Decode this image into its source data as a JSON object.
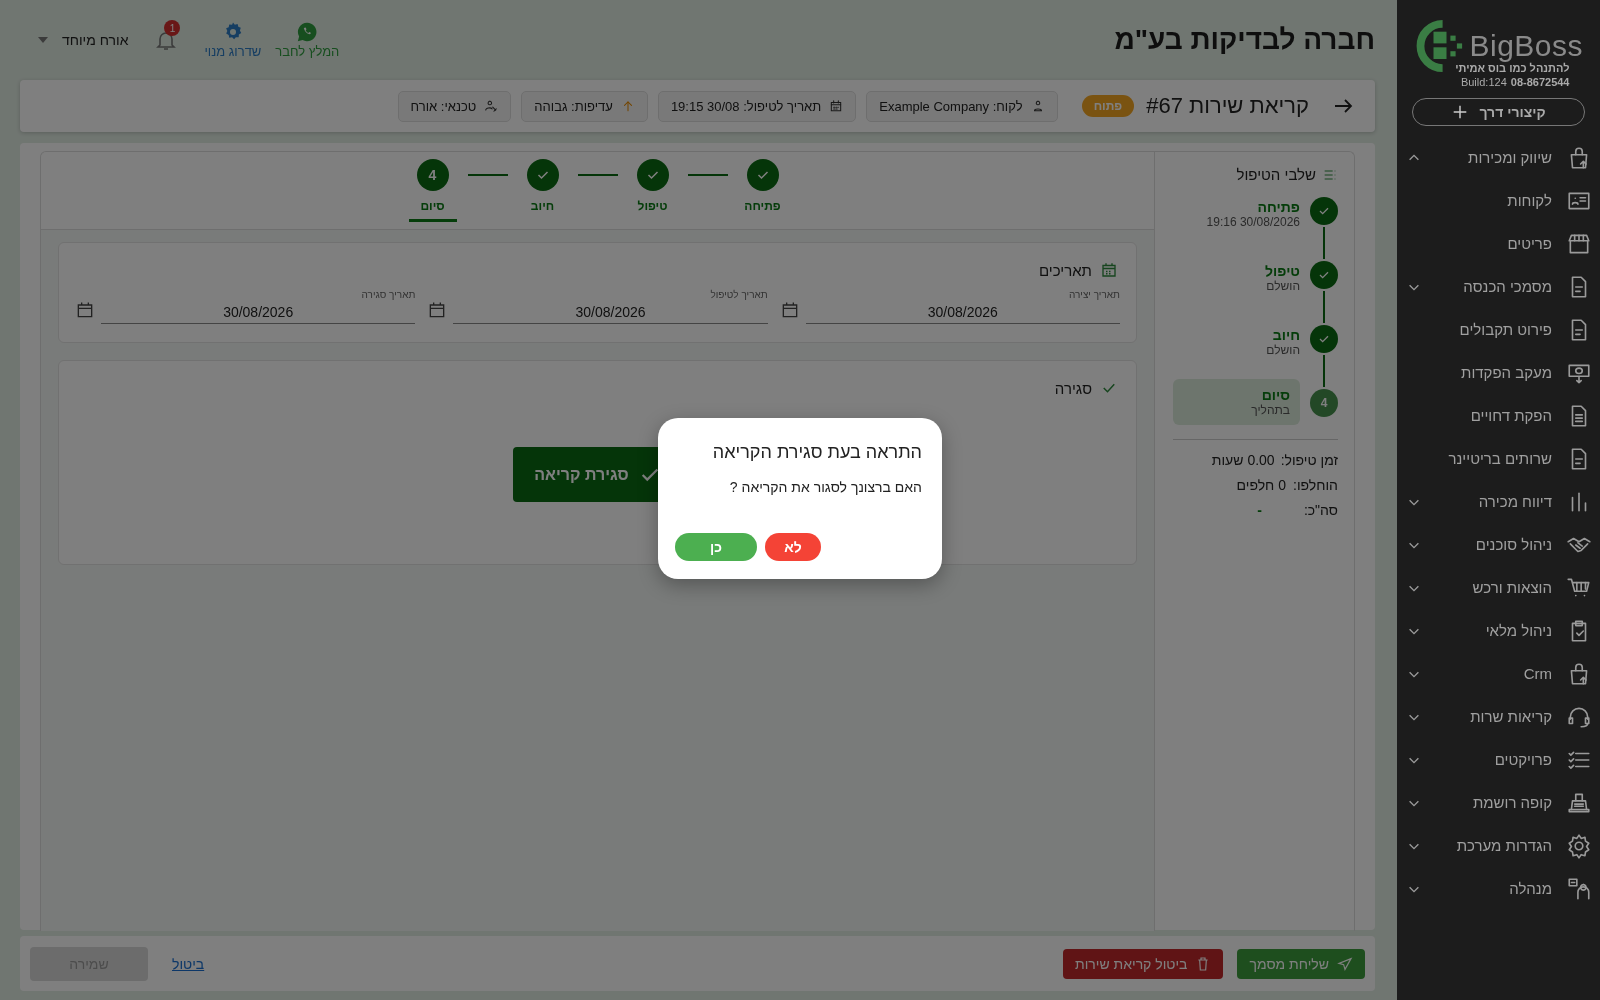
{
  "sidebar": {
    "brand": "BigBoss",
    "tagline": "להתנהל כמו בוס אמיתי",
    "phone": "08-8672544",
    "build": "Build:124",
    "shortcuts_button": "קיצורי דרך",
    "items": [
      {
        "label": "שיווק ומכירות",
        "expanded": true
      },
      {
        "label": "לקוחות"
      },
      {
        "label": "פריטים"
      },
      {
        "label": "מסמכי הכנסה",
        "expanded": false
      },
      {
        "label": "פירוט תקבולים"
      },
      {
        "label": "מעקב הפקדות"
      },
      {
        "label": "הפקת דחויים"
      },
      {
        "label": "שרותים בריטיינר"
      },
      {
        "label": "דיווח מכירה",
        "expanded": false
      },
      {
        "label": "ניהול סוכנים",
        "expanded": false
      },
      {
        "label": "הוצאות ורכש",
        "expanded": false
      },
      {
        "label": "ניהול מלאי",
        "expanded": false
      },
      {
        "label": "Crm",
        "expanded": false
      },
      {
        "label": "קריאות שרות",
        "expanded": false
      },
      {
        "label": "פרויקטים",
        "expanded": false
      },
      {
        "label": "קופה רושמת",
        "expanded": false
      },
      {
        "label": "הגדרות מערכת",
        "expanded": false
      },
      {
        "label": "מנהלה",
        "expanded": false
      }
    ]
  },
  "header": {
    "title": "חברה לבדיקות בע\"מ",
    "recommend": "המלץ לחבר",
    "upgrade": "שדרוג מנוי",
    "notifications": "1",
    "user": "אורח מיוחד"
  },
  "ticket": {
    "title": "קריאת שירות #67",
    "status": "פתוח",
    "chips": [
      "לקוח: Example Company",
      "תאריך לטיפול: 30/08 19:15",
      "עדיפות: גבוהה",
      "טכנאי: אורח"
    ]
  },
  "stepper": [
    {
      "label": "פתיחה",
      "done": true,
      "selected": false
    },
    {
      "label": "טיפול",
      "done": true,
      "selected": false
    },
    {
      "label": "חיוב",
      "done": true,
      "selected": false
    },
    {
      "label": "סיום",
      "done": false,
      "number": "4",
      "selected": true
    }
  ],
  "dates": {
    "title": "תאריכים",
    "fields": [
      {
        "label": "תאריך יצירה",
        "value": "30/08/2026"
      },
      {
        "label": "תאריך לטיפול",
        "value": "30/08/2026"
      },
      {
        "label": "תאריך סגירה",
        "value": "30/08/2026"
      }
    ]
  },
  "closing": {
    "title": "סגירה",
    "button": "סגירת קריאה"
  },
  "progress": {
    "title": "שלבי הטיפול",
    "steps": [
      {
        "title": "פתיחה",
        "subtitle": "30/08/2026 19:16",
        "done": true,
        "current": false
      },
      {
        "title": "טיפול",
        "subtitle": "הושלם",
        "done": true,
        "current": false
      },
      {
        "title": "חיוב",
        "subtitle": "הושלם",
        "done": true,
        "current": false
      },
      {
        "title": "סיום",
        "subtitle": "בתהליך",
        "done": false,
        "number": "4",
        "current": true
      }
    ],
    "stats": [
      {
        "label": "זמן טיפול:",
        "value": "0.00 שעות",
        "highlight": false
      },
      {
        "label": "הוחלפו:",
        "value": "0 חלפים",
        "highlight": false
      },
      {
        "label": "סה\"כ:",
        "value": "-",
        "highlight": true
      }
    ]
  },
  "footer": {
    "send": "שליחת מסמך",
    "cancel_ticket": "ביטול קריאת שירות",
    "cancel": "ביטול",
    "save": "שמירה",
    "save_disabled": true
  },
  "dialog": {
    "title": "התראה בעת סגירת הקריאה",
    "message": "האם ברצונך לסגור את הקריאה ?",
    "buttons": [
      {
        "label": "לא",
        "kind": "no"
      },
      {
        "label": "כן",
        "kind": "yes"
      }
    ]
  }
}
